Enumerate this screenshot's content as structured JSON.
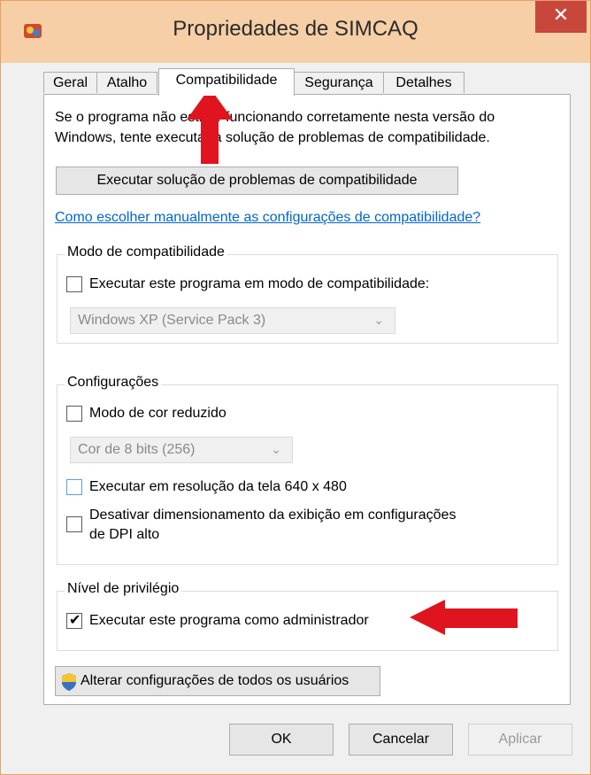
{
  "window": {
    "title": "Propriedades de SIMCAQ",
    "close_glyph": "✕"
  },
  "tabs": [
    {
      "label": "Geral",
      "active": false
    },
    {
      "label": "Atalho",
      "active": false
    },
    {
      "label": "Compatibilidade",
      "active": true
    },
    {
      "label": "Segurança",
      "active": false
    },
    {
      "label": "Detalhes",
      "active": false
    }
  ],
  "intro": {
    "line1": "Se o programa não estiver funcionando corretamente nesta versão do",
    "line2": "Windows, tente executar a solução de problemas de compatibilidade."
  },
  "troubleshoot_button": "Executar solução de problemas de compatibilidade",
  "manual_link": "Como escolher manualmente as configurações de compatibilidade?",
  "compat_mode": {
    "legend": "Modo de compatibilidade",
    "checkbox_label": "Executar este programa em modo de compatibilidade:",
    "checked": false,
    "select_value": "Windows XP (Service Pack 3)"
  },
  "settings": {
    "legend": "Configurações",
    "reduced_color_label": "Modo de cor reduzido",
    "color_select_value": "Cor de 8 bits (256)",
    "resolution_label": "Executar em resolução da tela 640 x 480",
    "dpi_label_line1": "Desativar dimensionamento da exibição em configurações",
    "dpi_label_line2": "de DPI alto"
  },
  "privilege": {
    "legend": "Nível de privilégio",
    "admin_label": "Executar este programa como administrador",
    "admin_checked": true
  },
  "all_users_button": "Alterar configurações de todos os usuários",
  "footer": {
    "ok": "OK",
    "cancel": "Cancelar",
    "apply": "Aplicar"
  },
  "colors": {
    "annotation_arrow": "#e0141e",
    "titlebar": "#f6cfa6",
    "close_button": "#c8473b",
    "link": "#0066cc"
  },
  "icons": {
    "app": "simcaq-app-icon",
    "shield": "uac-shield-icon",
    "chevron": "chevron-down-icon",
    "check": "checkmark-icon"
  }
}
